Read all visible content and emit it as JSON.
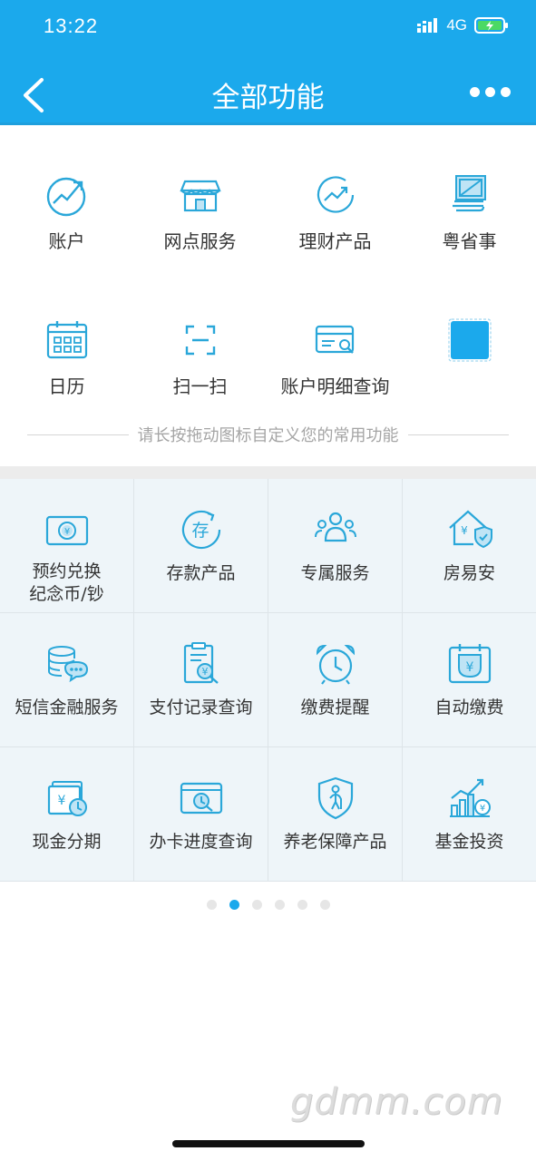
{
  "status": {
    "time": "13:22",
    "network": "4G"
  },
  "header": {
    "title": "全部功能"
  },
  "favorites": [
    {
      "label": "账户",
      "icon": "account-growth-icon"
    },
    {
      "label": "网点服务",
      "icon": "storefront-icon"
    },
    {
      "label": "理财产品",
      "icon": "wealth-chart-icon"
    },
    {
      "label": "粤省事",
      "icon": "document-stack-icon"
    },
    {
      "label": "日历",
      "icon": "calendar-icon"
    },
    {
      "label": "扫一扫",
      "icon": "scan-icon"
    },
    {
      "label": "账户明细查询",
      "icon": "card-search-icon"
    },
    {
      "label": "",
      "icon": "placeholder-slot-icon"
    }
  ],
  "hint": "请长按拖动图标自定义您的常用功能",
  "services": [
    {
      "label": "预约兑换\n纪念币/钞",
      "icon": "coin-banknote-icon"
    },
    {
      "label": "存款产品",
      "icon": "deposit-icon"
    },
    {
      "label": "专属服务",
      "icon": "group-users-icon"
    },
    {
      "label": "房易安",
      "icon": "house-shield-icon"
    },
    {
      "label": "短信金融服务",
      "icon": "coins-message-icon"
    },
    {
      "label": "支付记录查询",
      "icon": "receipt-search-icon"
    },
    {
      "label": "缴费提醒",
      "icon": "alarm-clock-icon"
    },
    {
      "label": "自动缴费",
      "icon": "auto-pay-calendar-icon"
    },
    {
      "label": "现金分期",
      "icon": "cash-installment-icon"
    },
    {
      "label": "办卡进度查询",
      "icon": "card-progress-icon"
    },
    {
      "label": "养老保障产品",
      "icon": "elder-shield-icon"
    },
    {
      "label": "基金投资",
      "icon": "fund-investment-icon"
    }
  ],
  "pagination": {
    "count": 6,
    "active_index": 1
  },
  "watermark": "gdmm.com",
  "colors": {
    "primary": "#1BA9EC",
    "icon_stroke": "#2AA7D9",
    "grid_bg": "#EEF5F9"
  }
}
